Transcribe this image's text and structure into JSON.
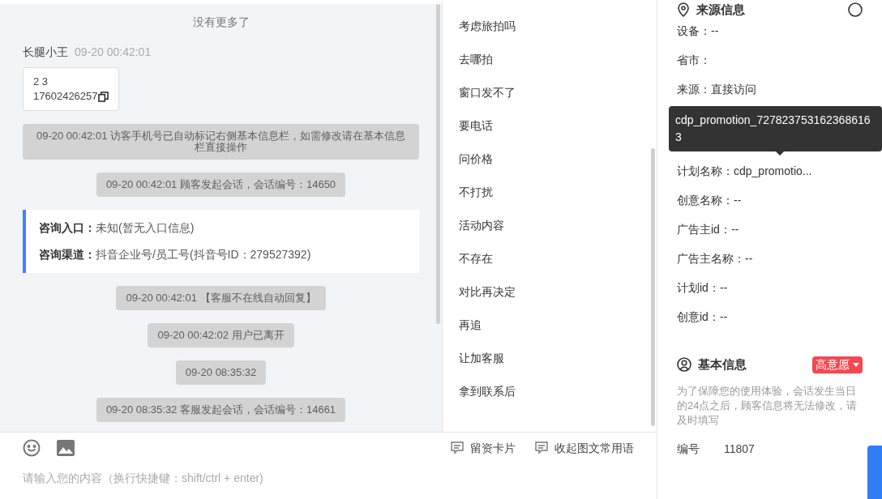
{
  "chat": {
    "no_more": "没有更多了",
    "messages": [
      {
        "kind": "user",
        "sender": "长腿小王",
        "time": "09-20 00:42:01",
        "lines": [
          "2 3",
          "17602426257"
        ]
      },
      {
        "kind": "system",
        "text": "09-20 00:42:01 访客手机号已自动标记右侧基本信息栏，如需修改请在基本信息栏直接操作"
      },
      {
        "kind": "system",
        "text": "09-20 00:42:01 顾客发起会话，会话编号：14650"
      },
      {
        "kind": "entry",
        "rows": [
          {
            "label": "咨询入口：",
            "value": "未知(暂无入口信息)"
          },
          {
            "label": "咨询渠道：",
            "value": "抖音企业号/员工号(抖音号ID：279527392)"
          }
        ]
      },
      {
        "kind": "system",
        "text": "09-20 00:42:01 【客服不在线自动回复】"
      },
      {
        "kind": "system",
        "text": "09-20 00:42:02 用户已离开"
      },
      {
        "kind": "system",
        "text": "09-20 08:35:32"
      },
      {
        "kind": "system",
        "text": "09-20 08:35:32 客服发起会话，会话编号：14661"
      }
    ]
  },
  "quick_replies": [
    "考虑旅拍吗",
    "去哪拍",
    "窗口发不了",
    "要电话",
    "问价格",
    "不打扰",
    "活动内容",
    "不存在",
    "对比再决定",
    "再追",
    "让加客服",
    "拿到联系后"
  ],
  "composer": {
    "actions": [
      "留资卡片",
      "收起图文常用语"
    ],
    "placeholder": "请输入您的内容（换行快捷键：shift/ctrl + enter)"
  },
  "source_info": {
    "title": "来源信息",
    "fields_top": [
      "设备：--",
      "省市：",
      "来源：直接访问"
    ],
    "tooltip": "cdp_promotion_7278237531623686163",
    "fields": [
      "计划名称：cdp_promotio...",
      "创意名称：--",
      "广告主id：--",
      "广告主名称：--",
      "计划id：--",
      "创意id：--"
    ]
  },
  "basic_info": {
    "title": "基本信息",
    "intent": "高意愿",
    "notice": "为了保障您的使用体验，会话发生当日的24点之后，顾客信息将无法修改，请及时填写",
    "id_label": "编号",
    "id_value": "11807"
  }
}
